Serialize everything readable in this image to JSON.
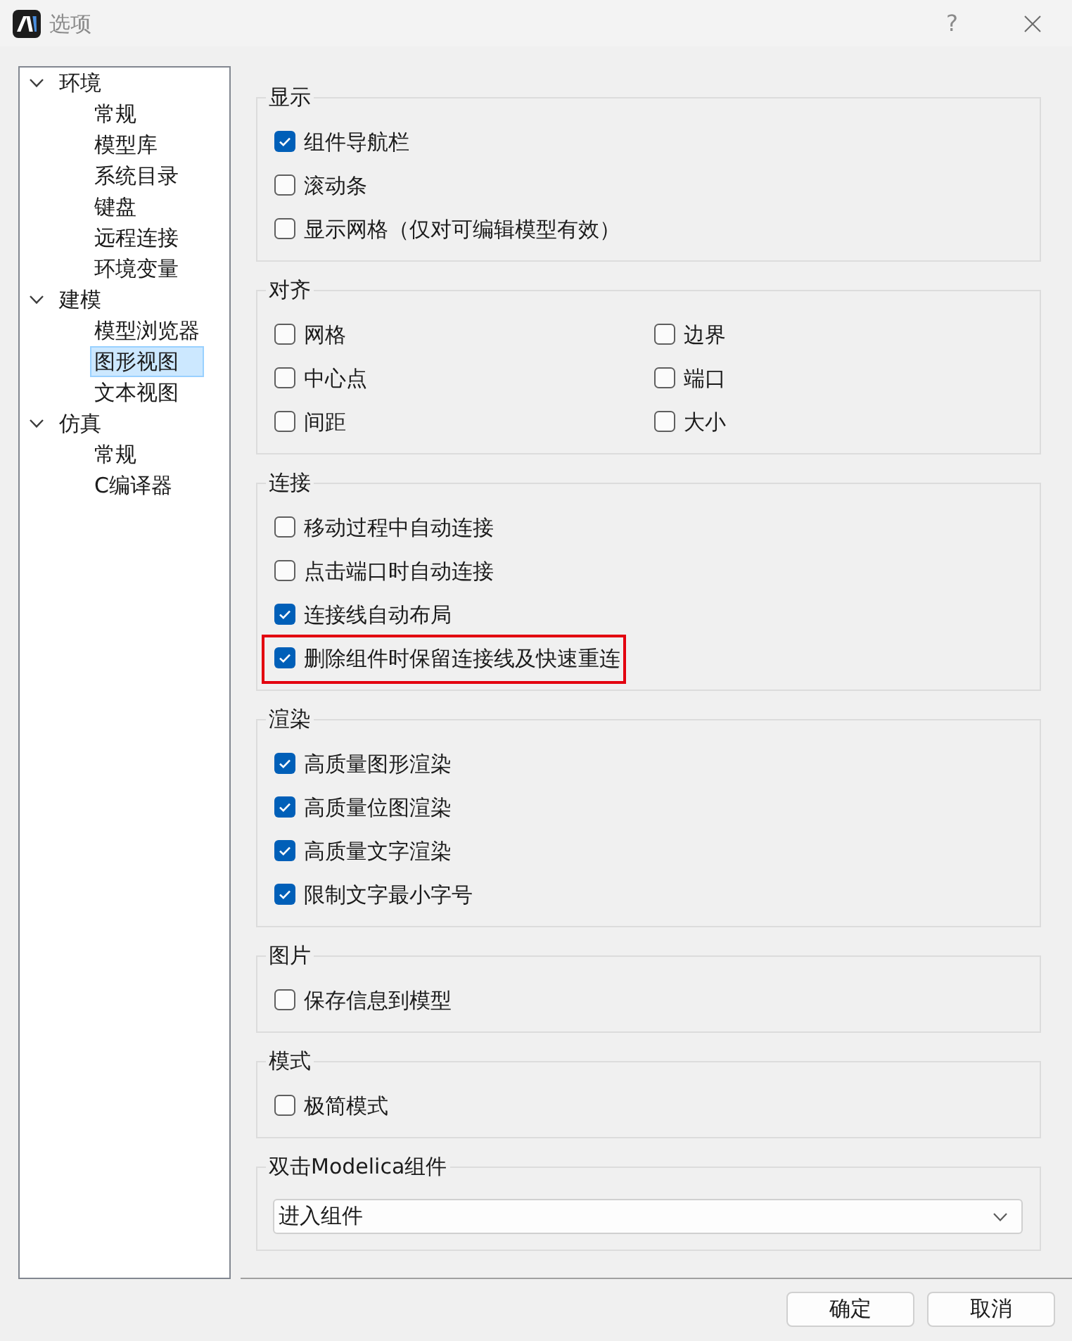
{
  "window": {
    "title": "选项",
    "help": "?"
  },
  "tree": [
    {
      "label": "环境",
      "expanded": true,
      "selected": false,
      "children": [
        {
          "label": "常规",
          "selected": false
        },
        {
          "label": "模型库",
          "selected": false
        },
        {
          "label": "系统目录",
          "selected": false
        },
        {
          "label": "键盘",
          "selected": false
        },
        {
          "label": "远程连接",
          "selected": false
        },
        {
          "label": "环境变量",
          "selected": false
        }
      ]
    },
    {
      "label": "建模",
      "expanded": true,
      "selected": false,
      "children": [
        {
          "label": "模型浏览器",
          "selected": false
        },
        {
          "label": "图形视图",
          "selected": true
        },
        {
          "label": "文本视图",
          "selected": false
        }
      ]
    },
    {
      "label": "仿真",
      "expanded": true,
      "selected": false,
      "children": [
        {
          "label": "常规",
          "selected": false
        },
        {
          "label": "C编译器",
          "selected": false
        }
      ]
    }
  ],
  "groups": [
    {
      "title": "显示",
      "kind": "list",
      "items": [
        {
          "label": "组件导航栏",
          "checked": true,
          "highlighted": false
        },
        {
          "label": "滚动条",
          "checked": false,
          "highlighted": false
        },
        {
          "label": "显示网格（仅对可编辑模型有效）",
          "checked": false,
          "highlighted": false
        }
      ]
    },
    {
      "title": "对齐",
      "kind": "grid",
      "items": [
        {
          "label": "网格",
          "checked": false,
          "highlighted": false
        },
        {
          "label": "边界",
          "checked": false,
          "highlighted": false
        },
        {
          "label": "中心点",
          "checked": false,
          "highlighted": false
        },
        {
          "label": "端口",
          "checked": false,
          "highlighted": false
        },
        {
          "label": "间距",
          "checked": false,
          "highlighted": false
        },
        {
          "label": "大小",
          "checked": false,
          "highlighted": false
        }
      ]
    },
    {
      "title": "连接",
      "kind": "list",
      "items": [
        {
          "label": "移动过程中自动连接",
          "checked": false,
          "highlighted": false
        },
        {
          "label": "点击端口时自动连接",
          "checked": false,
          "highlighted": false
        },
        {
          "label": "连接线自动布局",
          "checked": true,
          "highlighted": false
        },
        {
          "label": "删除组件时保留连接线及快速重连",
          "checked": true,
          "highlighted": true
        }
      ]
    },
    {
      "title": "渲染",
      "kind": "list",
      "items": [
        {
          "label": "高质量图形渲染",
          "checked": true,
          "highlighted": false
        },
        {
          "label": "高质量位图渲染",
          "checked": true,
          "highlighted": false
        },
        {
          "label": "高质量文字渲染",
          "checked": true,
          "highlighted": false
        },
        {
          "label": "限制文字最小字号",
          "checked": true,
          "highlighted": false
        }
      ]
    },
    {
      "title": "图片",
      "kind": "list",
      "items": [
        {
          "label": "保存信息到模型",
          "checked": false,
          "highlighted": false
        }
      ]
    },
    {
      "title": "模式",
      "kind": "list",
      "items": [
        {
          "label": "极简模式",
          "checked": false,
          "highlighted": false
        }
      ]
    },
    {
      "title": "双击Modelica组件",
      "kind": "dropdown",
      "value": "进入组件"
    }
  ],
  "buttons": [
    "确定",
    "取消"
  ]
}
